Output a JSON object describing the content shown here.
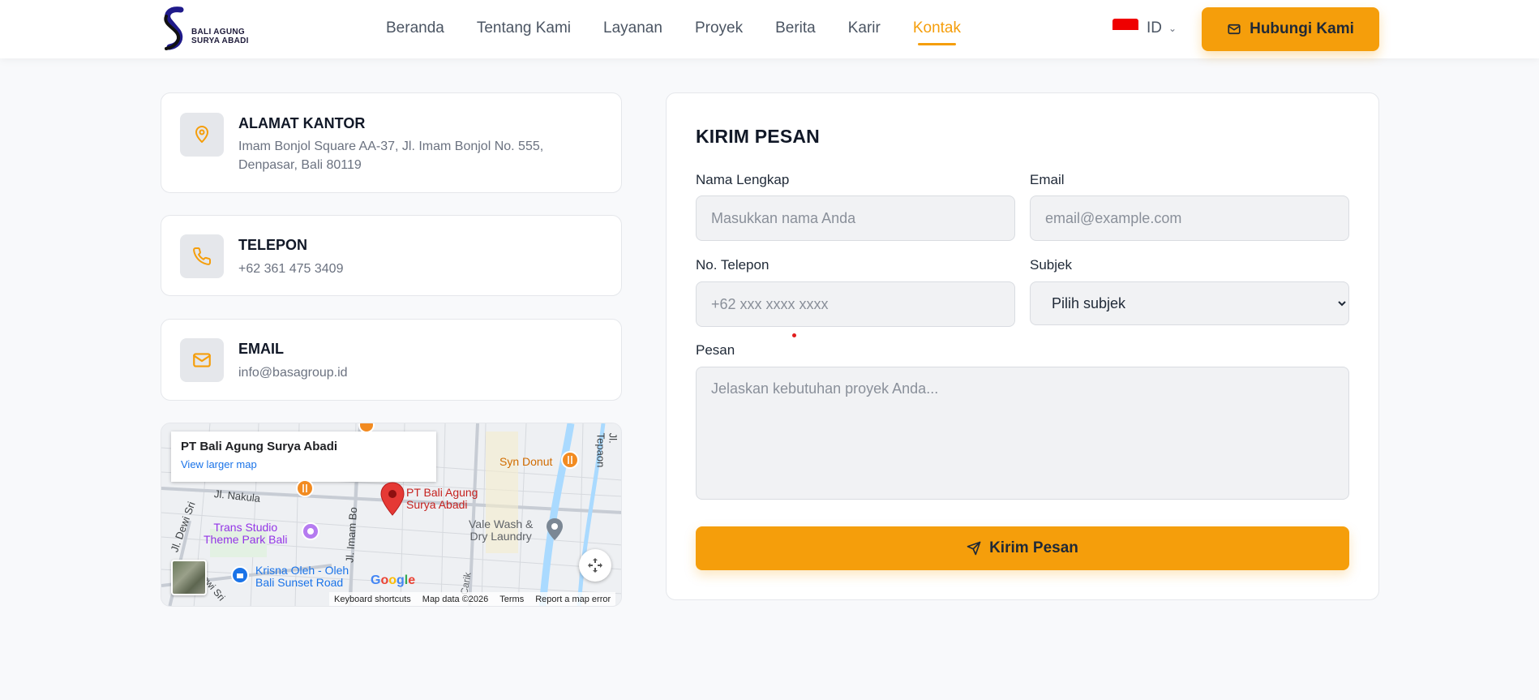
{
  "brand": {
    "line1": "BALI  AGUNG",
    "line2": "SURYA ABADI"
  },
  "nav": {
    "items": [
      {
        "label": "Beranda"
      },
      {
        "label": "Tentang Kami"
      },
      {
        "label": "Layanan"
      },
      {
        "label": "Proyek"
      },
      {
        "label": "Berita"
      },
      {
        "label": "Karir"
      },
      {
        "label": "Kontak",
        "active": true
      }
    ],
    "language": "ID",
    "cta_label": "Hubungi Kami"
  },
  "contact": {
    "address": {
      "title": "ALAMAT KANTOR",
      "line1": "Imam Bonjol Square AA-37, Jl. Imam Bonjol No. 555,",
      "line2": "Denpasar, Bali 80119",
      "icon": "map-pin-icon"
    },
    "phone": {
      "title": "TELEPON",
      "value": "+62 361 475 3409",
      "icon": "phone-icon"
    },
    "email": {
      "title": "EMAIL",
      "value": "info@basagroup.id",
      "icon": "mail-icon"
    }
  },
  "map": {
    "popup_title": "PT Bali Agung Surya Abadi",
    "popup_link": "View larger map",
    "marker_label_1": "PT Bali Agung",
    "marker_label_2": "Surya Abadi",
    "poi_syn": "Syn Donut",
    "poi_vale_1": "Vale Wash &",
    "poi_vale_2": "Dry Laundry",
    "poi_trans_1": "Trans Studio",
    "poi_trans_2": "Theme Park Bali",
    "poi_krisna_1": "Krisna Oleh - Oleh",
    "poi_krisna_2": "Bali Sunset Road",
    "street_nakula": "Jl. Nakula",
    "street_dewi": "Jl. Dewi Sri",
    "street_imam": "Jl. Imam Bo",
    "street_carik": "Carik",
    "street_pepaon": "Jl. Tepaon",
    "street_sri": "ewi Sri",
    "google": "Google",
    "footer": [
      "Keyboard shortcuts",
      "Map data ©2026",
      "Terms",
      "Report a map error"
    ]
  },
  "form": {
    "title": "KIRIM PESAN",
    "name_label": "Nama Lengkap",
    "name_placeholder": "Masukkan nama Anda",
    "email_label": "Email",
    "email_placeholder": "email@example.com",
    "phone_label": "No. Telepon",
    "phone_placeholder": "+62 xxx xxxx xxxx",
    "subject_label": "Subjek",
    "subject_selected": "Pilih subjek",
    "message_label": "Pesan",
    "message_placeholder": "Jelaskan kebutuhan proyek Anda...",
    "submit_label": "Kirim Pesan"
  },
  "colors": {
    "accent": "#f59e0b",
    "text": "#1f2937",
    "muted": "#6b7280",
    "bg": "#f8f9fb"
  }
}
